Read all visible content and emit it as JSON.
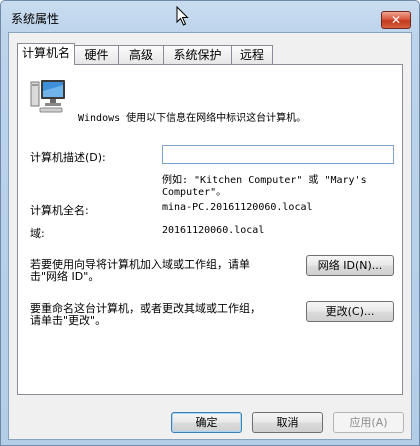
{
  "window": {
    "title": "系统属性",
    "close_glyph": "✕"
  },
  "tabs": [
    "计算机名",
    "硬件",
    "高级",
    "系统保护",
    "远程"
  ],
  "intro": "Windows 使用以下信息在网络中标识这台计算机。",
  "description": {
    "label": "计算机描述(D):",
    "value": "",
    "example_line1": "例如: \"Kitchen Computer\" 或 \"Mary's",
    "example_line2": "Computer\"。"
  },
  "full_name": {
    "label": "计算机全名:",
    "value": "mina-PC.20161120060.local"
  },
  "domain": {
    "label": "域:",
    "value": "20161120060.local"
  },
  "network_id": {
    "text_line1": "若要使用向导将计算机加入域或工作组，请单",
    "text_line2": "击\"网络 ID\"。",
    "button": "网络 ID(N)..."
  },
  "change": {
    "text_line1": "要重命名这台计算机，或者更改其域或工作组，",
    "text_line2": "请单击\"更改\"。",
    "button": "更改(C)..."
  },
  "footer": {
    "ok": "确定",
    "cancel": "取消",
    "apply": "应用(A)"
  },
  "colors": {
    "accent": "#3c7fb1",
    "close": "#c23a1e",
    "frame": "#b4cde6"
  }
}
